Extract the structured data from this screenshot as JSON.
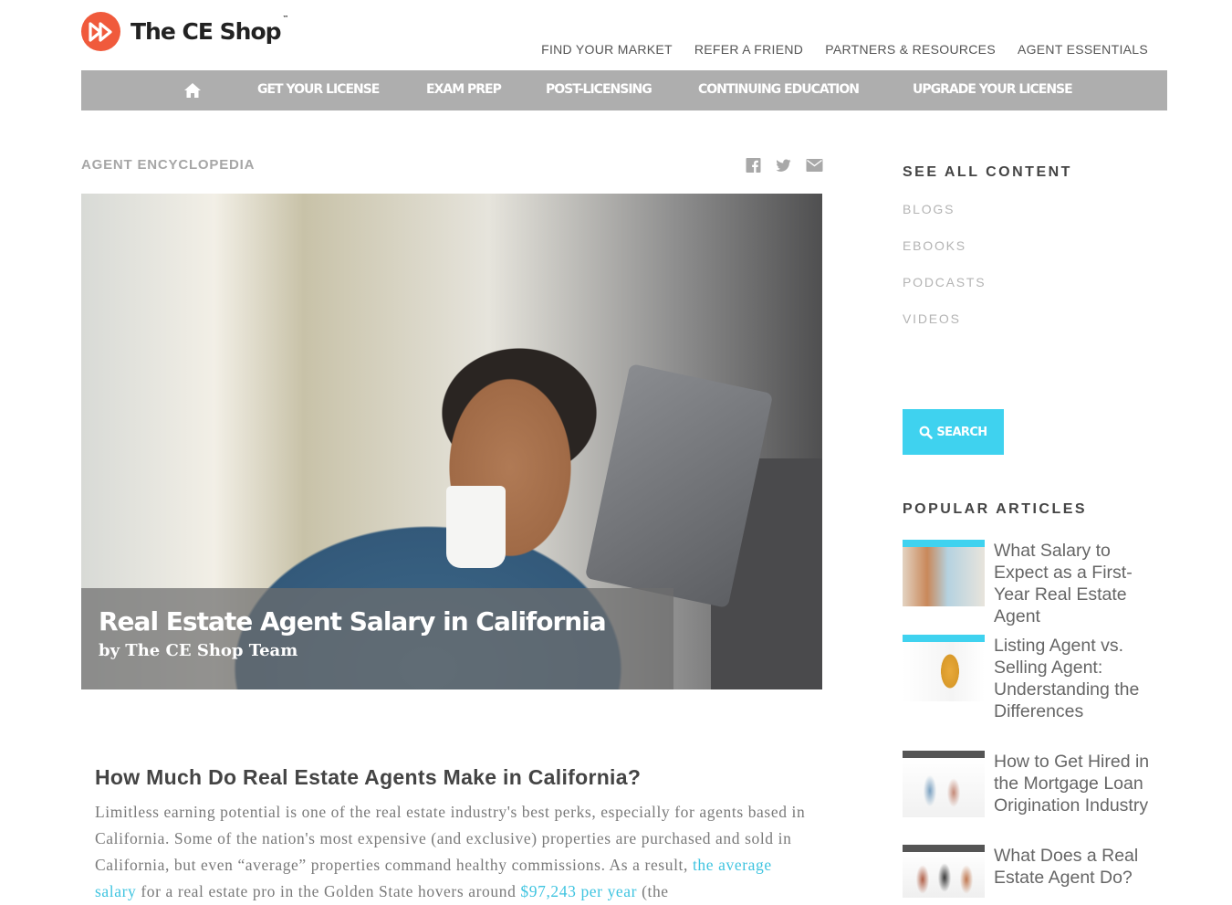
{
  "brand": {
    "name": "The CE Shop",
    "tm": "™",
    "accent": "#f05a3c"
  },
  "top_links": [
    "FIND YOUR MARKET",
    "REFER A FRIEND",
    "PARTNERS & RESOURCES",
    "AGENT ESSENTIALS"
  ],
  "main_nav": [
    "GET YOUR LICENSE",
    "EXAM PREP",
    "POST-LICENSING",
    "CONTINUING EDUCATION",
    "UPGRADE YOUR LICENSE"
  ],
  "section_label": "AGENT ENCYCLOPEDIA",
  "share": [
    "facebook-icon",
    "twitter-icon",
    "email-icon"
  ],
  "hero": {
    "title": "Real Estate Agent Salary in California",
    "byline": "by The CE Shop Team"
  },
  "article": {
    "heading": "How Much Do Real Estate Agents Make in California?",
    "p1_a": "Limitless earning potential is one of the real estate industry's best perks, especially for agents based in California. Some of the nation's most expensive (and exclusive) properties are purchased and sold in California, but even “average” properties command healthy commissions. As a result, ",
    "p1_link1": "the average salary",
    "p1_b": " for a real estate pro in the Golden State hovers around ",
    "p1_link2": "$97,243 per year",
    "p1_c": " (the"
  },
  "sidebar": {
    "see_all": "SEE ALL CONTENT",
    "content_links": [
      "BLOGS",
      "EBOOKS",
      "PODCASTS",
      "VIDEOS"
    ],
    "search_label": "SEARCH",
    "search_color": "#3fd2ef",
    "popular_heading": "POPULAR ARTICLES",
    "popular": [
      {
        "title": "What Salary to Expect as a First-Year Real Estate Agent",
        "bar_color": "#3fd2ef"
      },
      {
        "title": "Listing Agent vs. Selling Agent: Understanding the Differences",
        "bar_color": "#3fd2ef"
      },
      {
        "title": "How to Get Hired in the Mortgage Loan Origination Industry",
        "bar_color": "#555555"
      },
      {
        "title": "What Does a Real Estate Agent Do?",
        "bar_color": "#555555"
      }
    ]
  }
}
